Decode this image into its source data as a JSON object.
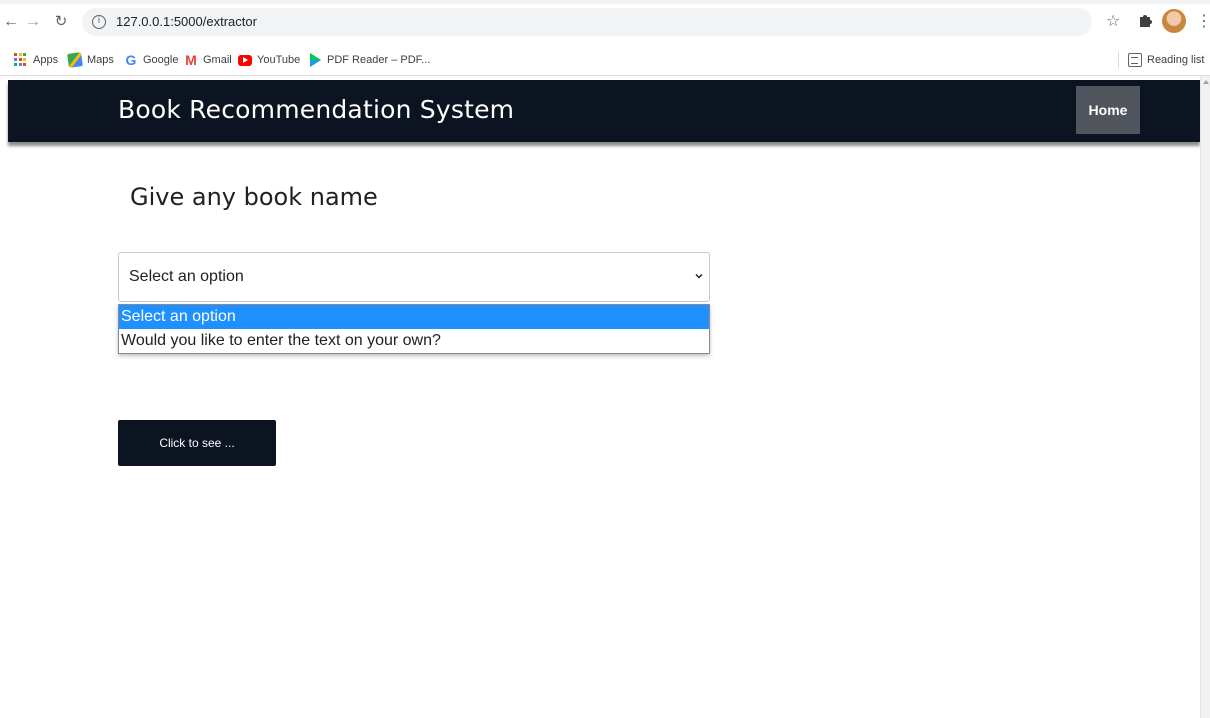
{
  "browser": {
    "url": "127.0.0.1:5000/extractor",
    "bookmarks": [
      {
        "label": "Apps",
        "icon": "apps-grid-icon"
      },
      {
        "label": "Maps",
        "icon": "maps-icon"
      },
      {
        "label": "Google",
        "icon": "google-icon"
      },
      {
        "label": "Gmail",
        "icon": "gmail-icon"
      },
      {
        "label": "YouTube",
        "icon": "youtube-icon"
      },
      {
        "label": "PDF Reader – PDF...",
        "icon": "google-play-icon"
      }
    ],
    "reading_list": "Reading list"
  },
  "navbar": {
    "brand": "Book Recommendation System",
    "home": "Home",
    "background": "#0d1421"
  },
  "main": {
    "heading": "Give any book name",
    "select": {
      "value": "Select an option",
      "options": [
        {
          "label": "Select an option",
          "selected": true
        },
        {
          "label": "Would you like to enter the text on your own?",
          "selected": false
        }
      ]
    },
    "submit": "Click to see ...",
    "highlight_color": "#1e90ff"
  }
}
